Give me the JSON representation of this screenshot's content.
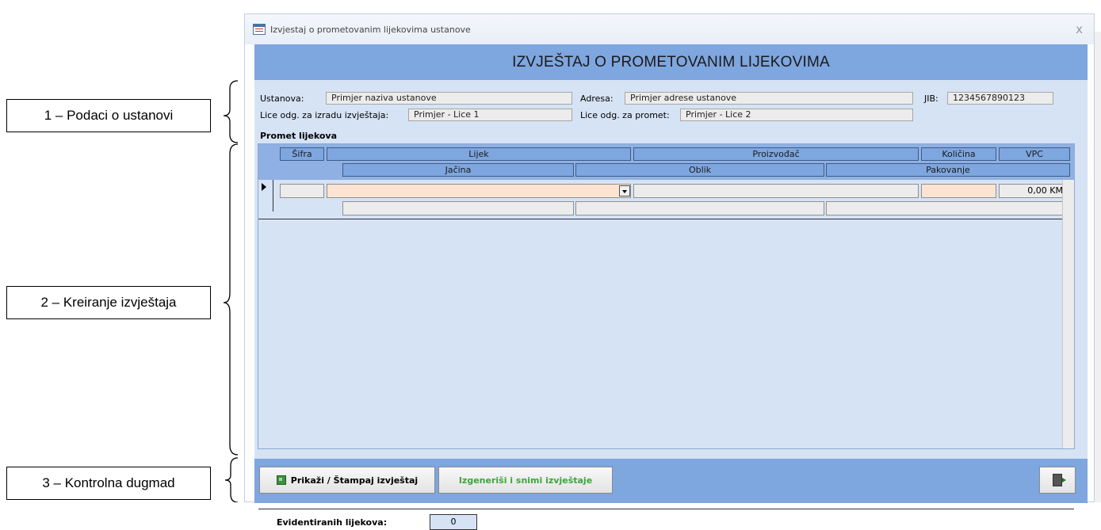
{
  "callouts": [
    {
      "label": "1 – Podaci o ustanovi"
    },
    {
      "label": "2 – Kreiranje izvještaja"
    },
    {
      "label": "3 – Kontrolna dugmad"
    }
  ],
  "window": {
    "title": "Izvjestaj o prometovanim lijekovima ustanove",
    "close": "x"
  },
  "report": {
    "heading": "IZVJEŠTAJ O PROMETOVANIM LIJEKOVIMA"
  },
  "institution": {
    "ustanova_label": "Ustanova:",
    "ustanova_value": "Primjer naziva ustanove",
    "adresa_label": "Adresa:",
    "adresa_value": "Primjer adrese ustanove",
    "jib_label": "JIB:",
    "jib_value": "1234567890123",
    "lice_izrada_label": "Lice odg. za izradu izvještaja:",
    "lice_izrada_value": "Primjer - Lice 1",
    "lice_promet_label": "Lice odg. za promet:",
    "lice_promet_value": "Primjer - Lice 2"
  },
  "promet": {
    "section_title": "Promet lijekova",
    "headers_row1": [
      "Šifra",
      "Lijek",
      "Proizvođač",
      "Količina",
      "VPC"
    ],
    "headers_row2": [
      "Jačina",
      "Oblik",
      "Pakovanje"
    ],
    "row": {
      "sifra": "",
      "lijek": "",
      "proizvodjac": "",
      "kolicina": "",
      "vpc": "0,00 KM",
      "jacina": "",
      "oblik": "",
      "pakovanje": ""
    },
    "count_label": "Evidentiranih lijekova:",
    "count_value": "0"
  },
  "buttons": {
    "print": "Prikaži / Štampaj izvještaj",
    "generate": "Izgeneriši i snimi izvještaje"
  },
  "colors": {
    "band": "#7ea6df",
    "content": "#d6e3f5",
    "peach": "#fde4d2",
    "generate_text": "#3aa63a"
  }
}
